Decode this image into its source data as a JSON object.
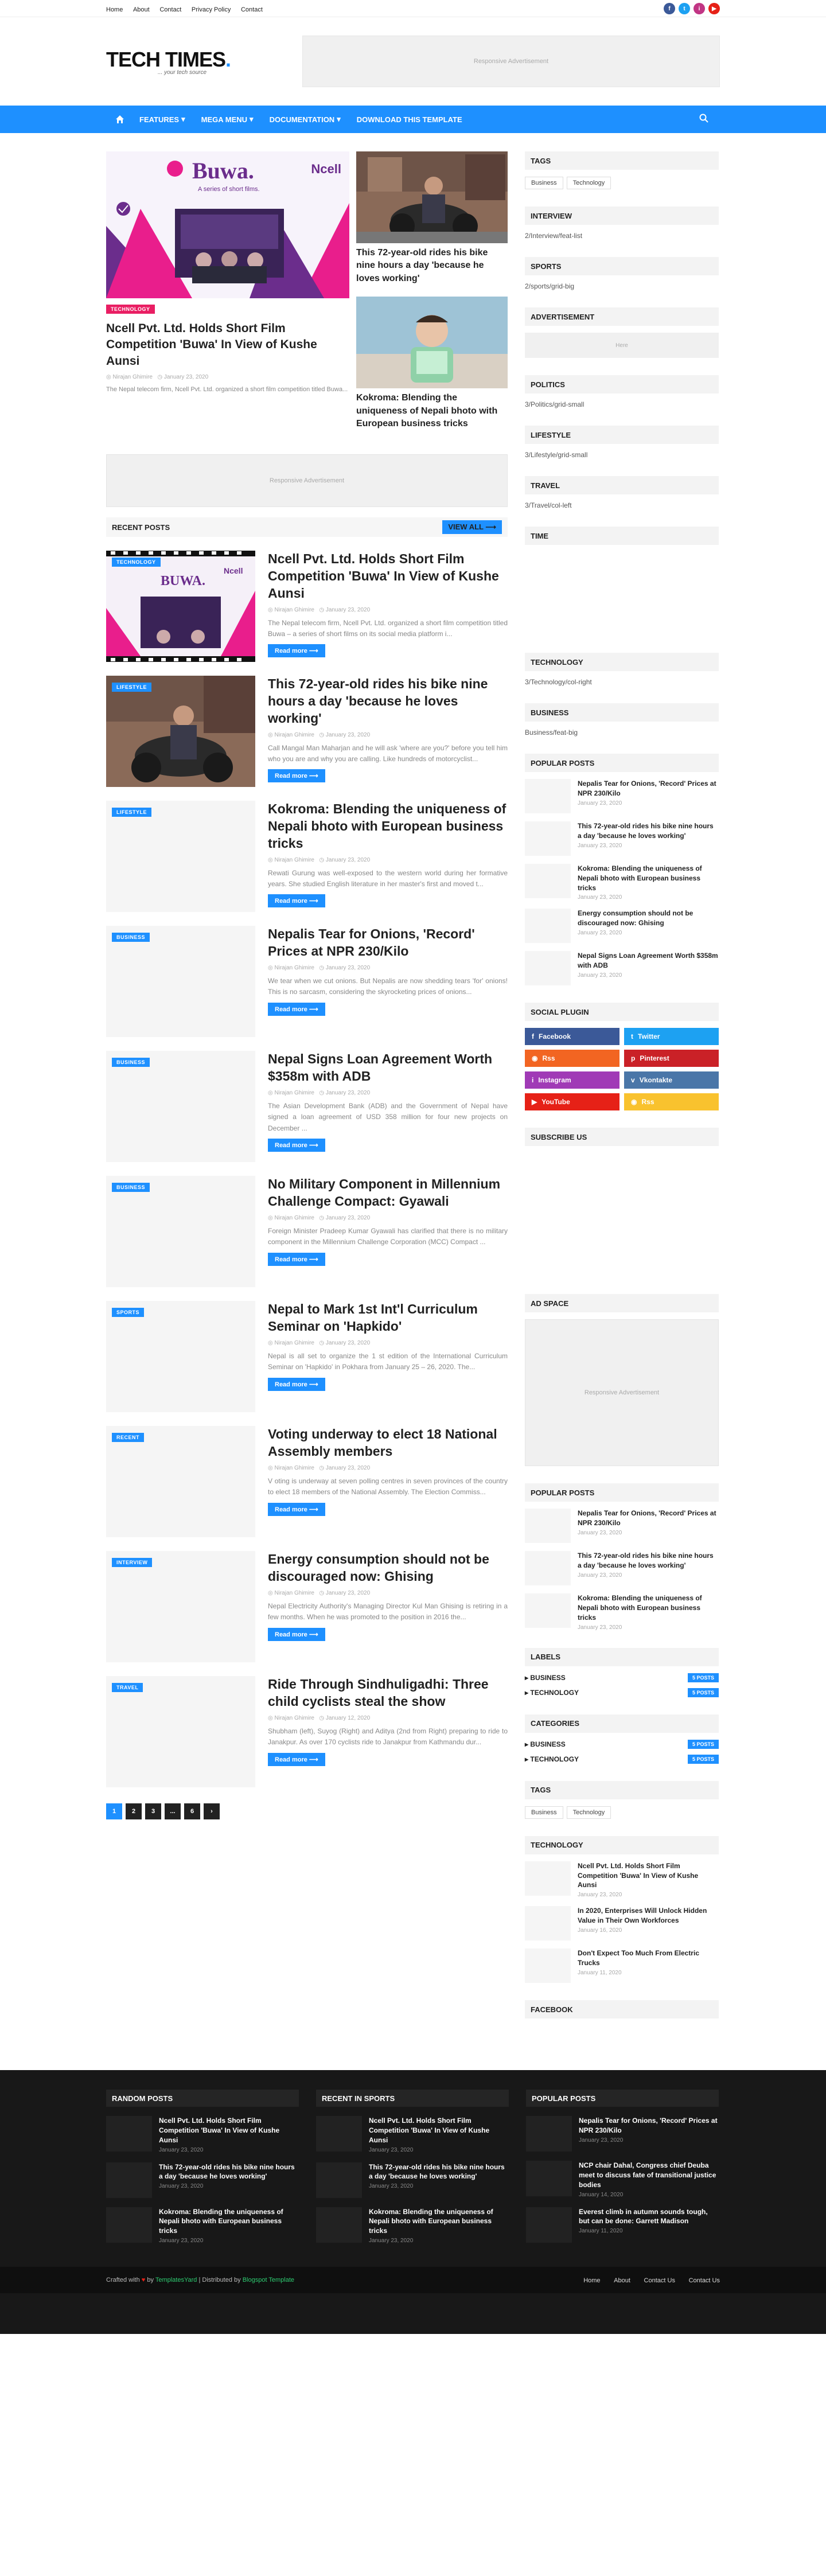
{
  "topbar": {
    "links": [
      "Home",
      "About",
      "Contact",
      "Privacy Policy",
      "Contact"
    ],
    "social": [
      {
        "icon": "facebook-icon",
        "glyph": "f",
        "color": "#3b5998"
      },
      {
        "icon": "twitter-icon",
        "glyph": "t",
        "color": "#1da1f2"
      },
      {
        "icon": "instagram-icon",
        "glyph": "i",
        "color": "#c13584"
      },
      {
        "icon": "youtube-icon",
        "glyph": "▶",
        "color": "#e62117"
      }
    ]
  },
  "header": {
    "logo_text": "TECH TIMES",
    "logo_dot": ".",
    "tagline": "... your tech source",
    "ad_text": "Responsive Advertisement"
  },
  "nav": {
    "items": [
      {
        "label": "FEATURES",
        "dropdown": true
      },
      {
        "label": "MEGA MENU",
        "dropdown": true
      },
      {
        "label": "DOCUMENTATION",
        "dropdown": true
      },
      {
        "label": "DOWNLOAD THIS TEMPLATE",
        "dropdown": false
      }
    ]
  },
  "featured": {
    "big": {
      "badge": "TECHNOLOGY",
      "title": "Ncell Pvt. Ltd. Holds Short Film Competition 'Buwa' In View of Kushe Aunsi",
      "author": "Nirajan Ghimire",
      "date": "January 23, 2020",
      "excerpt": "The Nepal telecom firm, Ncell Pvt. Ltd. organized a short film competition titled Buwa...",
      "image_text": "Buwa.",
      "image_sub": "A series of short films.",
      "image_brand": "Ncell"
    },
    "side": [
      {
        "title": "This 72-year-old rides his bike nine hours a day 'because he loves working'"
      },
      {
        "title": "Kokroma: Blending the uniqueness of Nepali bhoto with European business tricks"
      }
    ]
  },
  "content_ad": "Responsive Advertisement",
  "recent": {
    "title": "RECENT POSTS",
    "view_all": "VIEW ALL",
    "read_more": "Read more",
    "posts": [
      {
        "badge": "TECHNOLOGY",
        "badge_color": "#1e90ff",
        "title": "Ncell Pvt. Ltd. Holds Short Film Competition 'Buwa' In View of Kushe Aunsi",
        "author": "Nirajan Ghimire",
        "date": "January 23, 2020",
        "excerpt": "The Nepal telecom firm, Ncell Pvt. Ltd. organized a short film competition titled Buwa – a series of short films on its social media platform i..."
      },
      {
        "badge": "LIFESTYLE",
        "badge_color": "#1e90ff",
        "title": "This 72-year-old rides his bike nine hours a day 'because he loves working'",
        "author": "Nirajan Ghimire",
        "date": "January 23, 2020",
        "excerpt": "Call Mangal Man Maharjan and he will ask 'where are you?' before you tell him who you are and why you are calling. Like hundreds of motorcyclist..."
      },
      {
        "badge": "LIFESTYLE",
        "badge_color": "#1e90ff",
        "title": "Kokroma: Blending the uniqueness of Nepali bhoto with European business tricks",
        "author": "Nirajan Ghimire",
        "date": "January 23, 2020",
        "excerpt": "Rewati Gurung was well-exposed to the western world during her formative years. She studied English literature in her master's first and moved t..."
      },
      {
        "badge": "BUSINESS",
        "badge_color": "#1e90ff",
        "title": "Nepalis Tear for Onions, 'Record' Prices at NPR 230/Kilo",
        "author": "Nirajan Ghimire",
        "date": "January 23, 2020",
        "excerpt": "We tear when we cut onions. But Nepalis are now shedding tears 'for' onions! This is no sarcasm, considering the skyrocketing prices of onions..."
      },
      {
        "badge": "BUSINESS",
        "badge_color": "#1e90ff",
        "title": "Nepal Signs Loan Agreement Worth $358m with ADB",
        "author": "Nirajan Ghimire",
        "date": "January 23, 2020",
        "excerpt": "The Asian Development Bank (ADB) and the Government of Nepal have signed a loan agreement of USD 358 million for four new projects on December ..."
      },
      {
        "badge": "BUSINESS",
        "badge_color": "#1e90ff",
        "title": "No Military Component in Millennium Challenge Compact: Gyawali",
        "author": "Nirajan Ghimire",
        "date": "January 23, 2020",
        "excerpt": "Foreign Minister Pradeep Kumar Gyawali has clarified that there is no military component in the Millennium Challenge Corporation (MCC) Compact ..."
      },
      {
        "badge": "SPORTS",
        "badge_color": "#1e90ff",
        "title": "Nepal to Mark 1st Int'l Curriculum Seminar on 'Hapkido'",
        "author": "Nirajan Ghimire",
        "date": "January 23, 2020",
        "excerpt": "Nepal is all set to organize the 1 st edition of the International Curriculum Seminar on 'Hapkido' in Pokhara from January 25 – 26, 2020. The..."
      },
      {
        "badge": "RECENT",
        "badge_color": "#1e90ff",
        "title": "Voting underway to elect 18 National Assembly members",
        "author": "Nirajan Ghimire",
        "date": "January 23, 2020",
        "excerpt": "V oting is underway at seven polling centres in seven provinces of the country to elect 18 members of the National Assembly. The Election Commiss..."
      },
      {
        "badge": "INTERVIEW",
        "badge_color": "#1e90ff",
        "title": "Energy consumption should not be discouraged now: Ghising",
        "author": "Nirajan Ghimire",
        "date": "January 23, 2020",
        "excerpt": "Nepal Electricity Authority's Managing Director Kul Man Ghising is retiring in a few months. When he was promoted to the position in 2016 the..."
      },
      {
        "badge": "TRAVEL",
        "badge_color": "#1e90ff",
        "title": "Ride Through Sindhuligadhi: Three child cyclists steal the show",
        "author": "Nirajan Ghimire",
        "date": "January 12, 2020",
        "excerpt": "Shubham (left), Suyog (Right) and Aditya (2nd from Right) preparing to ride to Janakpur. As over 170 cyclists ride to Janakpur from Kathmandu dur..."
      }
    ]
  },
  "pager": [
    "1",
    "2",
    "3",
    "...",
    "6",
    "›"
  ],
  "sidebar": {
    "tags_title": "TAGS",
    "tags": [
      "Business",
      "Technology"
    ],
    "interview_title": "INTERVIEW",
    "interview_text": "2/Interview/feat-list",
    "sports_title": "SPORTS",
    "sports_text": "2/sports/grid-big",
    "advert_title": "ADVERTISEMENT",
    "advert_text": "Here",
    "politics_title": "POLITICS",
    "politics_text": "3/Politics/grid-small",
    "lifestyle_title": "LIFESTYLE",
    "lifestyle_text": "3/Lifestyle/grid-small",
    "travel_title": "TRAVEL",
    "travel_text": "3/Travel/col-left",
    "time_title": "TIME",
    "technology_title": "TECHNOLOGY",
    "technology_text": "3/Technology/col-right",
    "business_title": "BUSINESS",
    "business_text": "Business/feat-big",
    "popular_title": "POPULAR POSTS",
    "popular": [
      {
        "title": "Nepalis Tear for Onions, 'Record' Prices at NPR 230/Kilo",
        "date": "January 23, 2020"
      },
      {
        "title": "This 72-year-old rides his bike nine hours a day 'because he loves working'",
        "date": "January 23, 2020"
      },
      {
        "title": "Kokroma: Blending the uniqueness of Nepali bhoto with European business tricks",
        "date": "January 23, 2020"
      },
      {
        "title": "Energy consumption should not be discouraged now: Ghising",
        "date": "January 23, 2020"
      },
      {
        "title": "Nepal Signs Loan Agreement Worth $358m with ADB",
        "date": "January 23, 2020"
      }
    ],
    "social_title": "SOCIAL PLUGIN",
    "social": [
      {
        "label": "Facebook",
        "icon": "facebook-icon",
        "glyph": "f",
        "color": "#3b5998"
      },
      {
        "label": "Twitter",
        "icon": "twitter-icon",
        "glyph": "t",
        "color": "#1da1f2"
      },
      {
        "label": "Rss",
        "icon": "rss-icon",
        "glyph": "◉",
        "color": "#f26522"
      },
      {
        "label": "Pinterest",
        "icon": "pinterest-icon",
        "glyph": "p",
        "color": "#ca2127"
      },
      {
        "label": "Instagram",
        "icon": "instagram-icon",
        "glyph": "i",
        "color": "#a03ab6"
      },
      {
        "label": "Vkontakte",
        "icon": "vkontakte-icon",
        "glyph": "v",
        "color": "#4a76a8"
      },
      {
        "label": "YouTube",
        "icon": "youtube-icon",
        "glyph": "▶",
        "color": "#e62117"
      },
      {
        "label": "Rss",
        "icon": "rss-icon",
        "glyph": "◉",
        "color": "#f9c22e"
      }
    ],
    "subscribe_title": "SUBSCRIBE US",
    "adspace_title": "AD SPACE",
    "adspace_text": "Responsive Advertisement",
    "popular2": [
      {
        "title": "Nepalis Tear for Onions, 'Record' Prices at NPR 230/Kilo",
        "date": "January 23, 2020"
      },
      {
        "title": "This 72-year-old rides his bike nine hours a day 'because he loves working'",
        "date": "January 23, 2020"
      },
      {
        "title": "Kokroma: Blending the uniqueness of Nepali bhoto with European business tricks",
        "date": "January 23, 2020"
      }
    ],
    "labels_title": "LABELS",
    "labels": [
      {
        "name": "BUSINESS",
        "count": "5 POSTS"
      },
      {
        "name": "TECHNOLOGY",
        "count": "5 POSTS"
      }
    ],
    "categories_title": "CATEGORIES",
    "categories": [
      {
        "name": "BUSINESS",
        "count": "5 POSTS"
      },
      {
        "name": "TECHNOLOGY",
        "count": "5 POSTS"
      }
    ],
    "tags2_title": "TAGS",
    "tags2": [
      "Business",
      "Technology"
    ],
    "tech2_title": "TECHNOLOGY",
    "tech2": [
      {
        "title": "Ncell Pvt. Ltd. Holds Short Film Competition 'Buwa' In View of Kushe Aunsi",
        "date": "January 23, 2020"
      },
      {
        "title": "In 2020, Enterprises Will Unlock Hidden Value in Their Own Workforces",
        "date": "January 16, 2020"
      },
      {
        "title": "Don't Expect Too Much From Electric Trucks",
        "date": "January 11, 2020"
      }
    ],
    "facebook_title": "FACEBOOK"
  },
  "footer": {
    "random_title": "RANDOM POSTS",
    "random": [
      {
        "title": "Ncell Pvt. Ltd. Holds Short Film Competition 'Buwa' In View of Kushe Aunsi",
        "date": "January 23, 2020"
      },
      {
        "title": "This 72-year-old rides his bike nine hours a day 'because he loves working'",
        "date": "January 23, 2020"
      },
      {
        "title": "Kokroma: Blending the uniqueness of Nepali bhoto with European business tricks",
        "date": "January 23, 2020"
      }
    ],
    "sports_title": "RECENT IN SPORTS",
    "sports": [
      {
        "title": "Ncell Pvt. Ltd. Holds Short Film Competition 'Buwa' In View of Kushe Aunsi",
        "date": "January 23, 2020"
      },
      {
        "title": "This 72-year-old rides his bike nine hours a day 'because he loves working'",
        "date": "January 23, 2020"
      },
      {
        "title": "Kokroma: Blending the uniqueness of Nepali bhoto with European business tricks",
        "date": "January 23, 2020"
      }
    ],
    "popular_title": "POPULAR POSTS",
    "popular": [
      {
        "title": "Nepalis Tear for Onions, 'Record' Prices at NPR 230/Kilo",
        "date": "January 23, 2020"
      },
      {
        "title": "NCP chair Dahal, Congress chief Deuba meet to discuss fate of transitional justice bodies",
        "date": "January 14, 2020"
      },
      {
        "title": "Everest climb in autumn sounds tough, but can be done: Garrett Madison",
        "date": "January 11, 2020"
      }
    ],
    "crafted": "Crafted with",
    "by": "by",
    "templates_fav": "TemplatesYard",
    "distributed": "| Distributed by",
    "blogger": "Blogspot Template",
    "links": [
      "Home",
      "About",
      "Contact Us",
      "Contact Us"
    ]
  }
}
